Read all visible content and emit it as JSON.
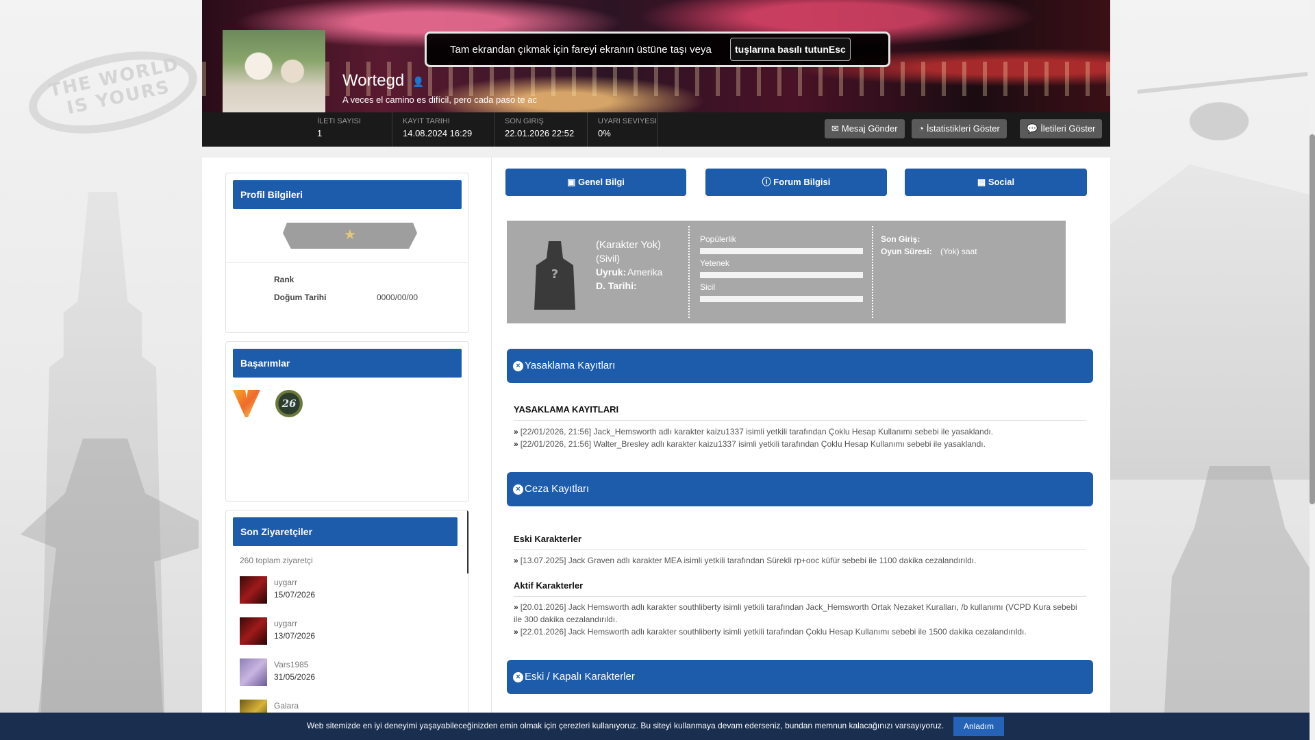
{
  "background": {
    "blimp_text": "THE WORLD IS YOURS"
  },
  "fullscreen_tip": {
    "text": "Tam ekrandan çıkmak için fareyi ekranın üstüne taşı veya",
    "key": "tuşlarına basılı tutunEsc"
  },
  "profile": {
    "username": "Wortegd",
    "motto": "A veces el camino es difícil, pero cada paso te ac",
    "stats": [
      {
        "label": "İLETI SAYISI",
        "value": "1"
      },
      {
        "label": "KAYIT TARIHI",
        "value": "14.08.2024 16:29"
      },
      {
        "label": "SON GIRIŞ",
        "value": "22.01.2026 22:52"
      },
      {
        "label": "UYARI SEVIYESI",
        "value": "0%"
      }
    ],
    "actions": [
      {
        "icon": "✉",
        "label": "Mesaj Gönder"
      },
      {
        "icon": "◔",
        "label": "İstatistikleri Göster"
      },
      {
        "icon": "💬",
        "label": "İletileri Göster"
      }
    ]
  },
  "sidebar": {
    "profile_info": {
      "title": "Profil Bilgileri",
      "rank_label": "Rank",
      "birth_label": "Doğum Tarihi",
      "birth_value": "0000/00/00"
    },
    "achievements": {
      "title": "Başarımlar",
      "badge_26": "26"
    },
    "visitors": {
      "title": "Son Ziyaretçiler",
      "total": "260 toplam ziyaretçi",
      "items": [
        {
          "name": "uygarr",
          "date": "15/07/2026"
        },
        {
          "name": "uygarr",
          "date": "13/07/2026"
        },
        {
          "name": "Vars1985",
          "date": "31/05/2026"
        },
        {
          "name": "Galara",
          "date": ""
        }
      ]
    }
  },
  "tabs": [
    {
      "icon": "▣",
      "label": "Genel Bilgi"
    },
    {
      "icon": "ⓘ",
      "label": "Forum Bilgisi"
    },
    {
      "icon": "▦",
      "label": "Social"
    }
  ],
  "character": {
    "name": "(Karakter Yok)",
    "role": "(Sivil)",
    "nationality_label": "Uyruk:",
    "nationality_value": "Amerika",
    "birth_label": "D. Tarihi:",
    "meters": [
      {
        "label": "Popülerlik",
        "value": 0
      },
      {
        "label": "Yetenek",
        "value": 0
      },
      {
        "label": "Sicil",
        "value": 0
      }
    ],
    "last_login_label": "Son Giriş:",
    "playtime_label": "Oyun Süresi:",
    "playtime_value": "(Yok) saat"
  },
  "bans": {
    "section_title": "Yasaklama Kayıtları",
    "subtitle": "YASAKLAMA KAYITLARI",
    "entries": [
      "[22/01/2026, 21:56] Jack_Hemsworth adlı karakter kaizu1337 isimli yetkili tarafından Çoklu Hesap Kullanımı sebebi ile yasaklandı.",
      "[22/01/2026, 21:56] Walter_Bresley adlı karakter kaizu1337 isimli yetkili tarafından Çoklu Hesap Kullanımı sebebi ile yasaklandı."
    ]
  },
  "penalties": {
    "section_title": "Ceza Kayıtları",
    "old_title": "Eski Karakterler",
    "old_entries": [
      "[13.07.2025] Jack Graven adlı karakter MEA isimli yetkili tarafından Sürekli rp+ooc küfür sebebi ile 1100 dakika cezalandırıldı."
    ],
    "active_title": "Aktif Karakterler",
    "active_entries": [
      "[20.01.2026] Jack Hemsworth adlı karakter southliberty isimli yetkili tarafından Jack_Hemsworth Ortak Nezaket Kuralları, /b kullanımı (VCPD Kura sebebi ile 300 dakika cezalandırıldı.",
      "[22.01.2026] Jack Hemsworth adlı karakter southliberty isimli yetkili tarafından Çoklu Hesap Kullanımı sebebi ile 1500 dakika cezalandırıldı."
    ]
  },
  "old_characters": {
    "section_title": "Eski / Kapalı Karakterler"
  },
  "cookie": {
    "text": "Web sitemizde en iyi deneyimi yaşayabileceğinizden emin olmak için çerezleri kullanıyoruz. Bu siteyi kullanmaya devam ederseniz, bundan memnun kalacağınızı varsayıyoruz.",
    "button": "Anladım"
  },
  "colors": {
    "primary": "#1d5bab",
    "header_bar": "#1a1a1a",
    "cookie_bar": "#1a2e4f",
    "char_card": "#a8a8a8"
  }
}
